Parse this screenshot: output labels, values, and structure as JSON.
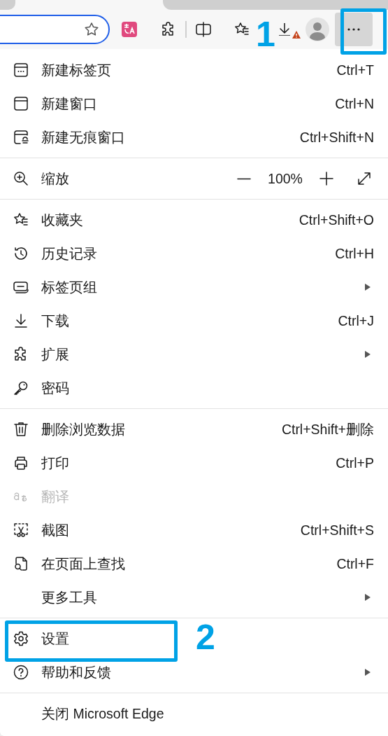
{
  "toolbar": {
    "more_button": {
      "pressed": true
    },
    "download_warning": true
  },
  "menu": {
    "sections": [
      {
        "items": [
          {
            "kind": "item",
            "label": "新建标签页",
            "shortcut": "Ctrl+T",
            "submenu": false,
            "disabled": false
          },
          {
            "kind": "item",
            "label": "新建窗口",
            "shortcut": "Ctrl+N",
            "submenu": false,
            "disabled": false
          },
          {
            "kind": "item",
            "label": "新建无痕窗口",
            "shortcut": "Ctrl+Shift+N",
            "submenu": false,
            "disabled": false
          }
        ]
      },
      {
        "items": [
          {
            "kind": "zoom",
            "label": "缩放",
            "value": "100%"
          }
        ]
      },
      {
        "items": [
          {
            "kind": "item",
            "label": "收藏夹",
            "shortcut": "Ctrl+Shift+O",
            "submenu": false,
            "disabled": false
          },
          {
            "kind": "item",
            "label": "历史记录",
            "shortcut": "Ctrl+H",
            "submenu": false,
            "disabled": false
          },
          {
            "kind": "item",
            "label": "标签页组",
            "submenu": true,
            "disabled": false
          },
          {
            "kind": "item",
            "label": "下载",
            "shortcut": "Ctrl+J",
            "submenu": false,
            "disabled": false
          },
          {
            "kind": "item",
            "label": "扩展",
            "submenu": true,
            "disabled": false
          },
          {
            "kind": "item",
            "label": "密码",
            "submenu": false,
            "disabled": false
          }
        ]
      },
      {
        "items": [
          {
            "kind": "item",
            "label": "删除浏览数据",
            "shortcut": "Ctrl+Shift+删除",
            "submenu": false,
            "disabled": false
          },
          {
            "kind": "item",
            "label": "打印",
            "shortcut": "Ctrl+P",
            "submenu": false,
            "disabled": false
          },
          {
            "kind": "item",
            "label": "翻译",
            "submenu": false,
            "disabled": true
          },
          {
            "kind": "item",
            "label": "截图",
            "shortcut": "Ctrl+Shift+S",
            "submenu": false,
            "disabled": false
          },
          {
            "kind": "item",
            "label": "在页面上查找",
            "shortcut": "Ctrl+F",
            "submenu": false,
            "disabled": false
          },
          {
            "kind": "item",
            "label": "更多工具",
            "submenu": true,
            "disabled": false
          }
        ]
      },
      {
        "items": [
          {
            "kind": "item",
            "label": "设置",
            "submenu": false,
            "disabled": false
          },
          {
            "kind": "item",
            "label": "帮助和反馈",
            "submenu": true,
            "disabled": false
          }
        ]
      },
      {
        "items": [
          {
            "kind": "item",
            "label": "关闭 Microsoft Edge",
            "submenu": false,
            "disabled": false
          }
        ]
      }
    ]
  },
  "annotations": [
    {
      "label": "1"
    },
    {
      "label": "2"
    }
  ]
}
